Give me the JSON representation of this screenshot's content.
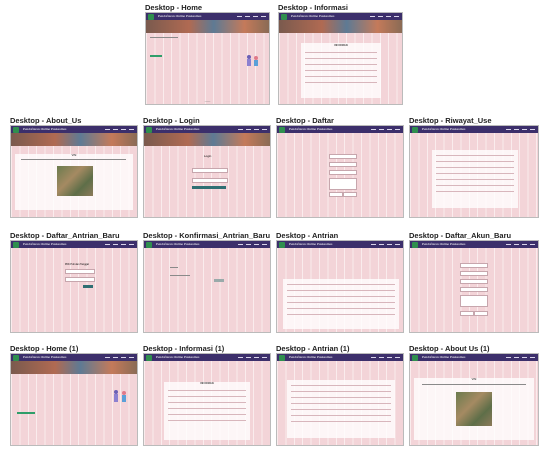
{
  "frames": [
    {
      "id": "home",
      "title": "Desktop - Home",
      "header": "Pendaftaran Online\nPuskesmas"
    },
    {
      "id": "informasi",
      "title": "Desktop - Informasi",
      "header": "Pendaftaran Online\nPuskesmas",
      "card_title": "INFORMASI"
    },
    {
      "id": "about",
      "title": "Desktop - About_Us",
      "header": "Pendaftaran Online\nPuskesmas",
      "card_title": "VISI"
    },
    {
      "id": "login",
      "title": "Desktop - Login",
      "header": "Pendaftaran Online\nPuskesmas",
      "card_title": "Login"
    },
    {
      "id": "daftar",
      "title": "Desktop - Daftar",
      "header": "Pendaftaran Online\nPuskesmas"
    },
    {
      "id": "riwayat",
      "title": "Desktop - Riwayat_Use",
      "header": "Pendaftaran Online\nPuskesmas"
    },
    {
      "id": "daftar_antrian",
      "title": "Desktop - Daftar_Antrian_Baru",
      "header": "Pendaftaran Online\nPuskesmas",
      "card_title": "Pilih Poli dan Tanggal"
    },
    {
      "id": "konfirmasi",
      "title": "Desktop - Konfirmasi_Antrian_Baru",
      "header": "Pendaftaran Online\nPuskesmas"
    },
    {
      "id": "table",
      "title": "Desktop - Antrian",
      "header": "Pendaftaran Online\nPuskesmas"
    },
    {
      "id": "edit",
      "title": "Desktop - Daftar_Akun_Baru",
      "header": "Pendaftaran Online\nPuskesmas"
    },
    {
      "id": "home2",
      "title": "Desktop - Home (1)",
      "header": "Pendaftaran Online\nPuskesmas"
    },
    {
      "id": "informasi2",
      "title": "Desktop - Informasi (1)",
      "header": "Pendaftaran Online\nPuskesmas",
      "card_title": "INFORMASI"
    },
    {
      "id": "table2",
      "title": "Desktop - Antrian (1)",
      "header": "Pendaftaran Online\nPuskesmas"
    },
    {
      "id": "about2",
      "title": "Desktop - About Us (1)",
      "header": "Pendaftaran Online\nPuskesmas",
      "card_title": "VISI"
    }
  ],
  "colors": {
    "header": "#3c2f6b",
    "frame_bg": "#f3d4d8",
    "accent": "#2f6f73"
  }
}
